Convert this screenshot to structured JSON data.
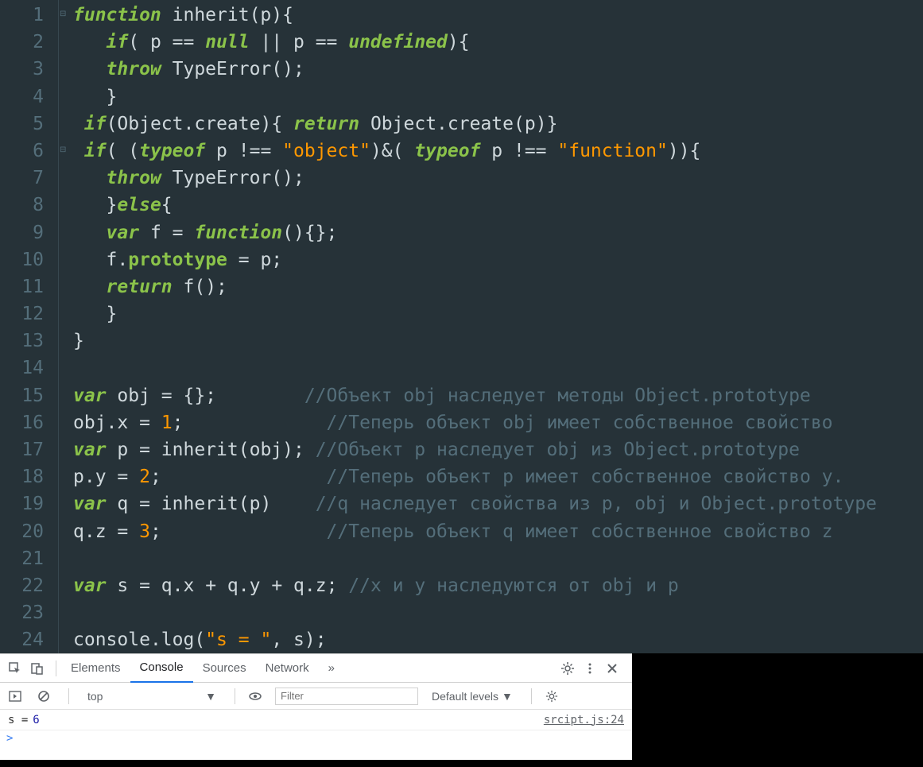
{
  "editor": {
    "line_count": 24,
    "fold_markers": [
      1,
      6
    ],
    "lines": [
      {
        "n": 1,
        "tokens": [
          [
            "kw",
            "function"
          ],
          [
            "fn",
            " inherit"
          ],
          [
            "pun",
            "("
          ],
          [
            "fn",
            "p"
          ],
          [
            "pun",
            "){"
          ]
        ]
      },
      {
        "n": 2,
        "indent": 1,
        "tokens": [
          [
            "kw",
            "if"
          ],
          [
            "pun",
            "( "
          ],
          [
            "fn",
            "p"
          ],
          [
            "op",
            " == "
          ],
          [
            "kw",
            "null"
          ],
          [
            "op",
            " || "
          ],
          [
            "fn",
            "p"
          ],
          [
            "op",
            " == "
          ],
          [
            "kw",
            "undefined"
          ],
          [
            "pun",
            "){"
          ]
        ]
      },
      {
        "n": 3,
        "indent": 1,
        "tokens": [
          [
            "kw",
            "throw"
          ],
          [
            "fn",
            " TypeError"
          ],
          [
            "pun",
            "();"
          ]
        ]
      },
      {
        "n": 4,
        "indent": 1,
        "tokens": [
          [
            "pun",
            "}"
          ]
        ]
      },
      {
        "n": 5,
        "indent": 0,
        "tokens": [
          [
            "kw",
            "if"
          ],
          [
            "pun",
            "("
          ],
          [
            "fn",
            "Object"
          ],
          [
            "pun",
            "."
          ],
          [
            "fn",
            "create"
          ],
          [
            "pun",
            "){ "
          ],
          [
            "kw",
            "return"
          ],
          [
            "fn",
            " Object"
          ],
          [
            "pun",
            "."
          ],
          [
            "fn",
            "create"
          ],
          [
            "pun",
            "("
          ],
          [
            "fn",
            "p"
          ],
          [
            "pun",
            ")}"
          ]
        ]
      },
      {
        "n": 6,
        "indent": 0,
        "tokens": [
          [
            "kw",
            "if"
          ],
          [
            "pun",
            "( ("
          ],
          [
            "kw",
            "typeof"
          ],
          [
            "fn",
            " p"
          ],
          [
            "op",
            " !== "
          ],
          [
            "str",
            "\"object\""
          ],
          [
            "pun",
            ")&( "
          ],
          [
            "kw",
            "typeof"
          ],
          [
            "fn",
            " p"
          ],
          [
            "op",
            " !== "
          ],
          [
            "str",
            "\"function\""
          ],
          [
            "pun",
            ")){"
          ]
        ]
      },
      {
        "n": 7,
        "indent": 1,
        "tokens": [
          [
            "kw",
            "throw"
          ],
          [
            "fn",
            " TypeError"
          ],
          [
            "pun",
            "();"
          ]
        ]
      },
      {
        "n": 8,
        "indent": 1,
        "tokens": [
          [
            "pun",
            "}"
          ],
          [
            "kw",
            "else"
          ],
          [
            "pun",
            "{"
          ]
        ]
      },
      {
        "n": 9,
        "indent": 1,
        "tokens": [
          [
            "kw",
            "var"
          ],
          [
            "fn",
            " f"
          ],
          [
            "op",
            " = "
          ],
          [
            "kw",
            "function"
          ],
          [
            "pun",
            "(){};"
          ]
        ]
      },
      {
        "n": 10,
        "indent": 1,
        "tokens": [
          [
            "fn",
            "f"
          ],
          [
            "pun",
            "."
          ],
          [
            "prop",
            "prototype"
          ],
          [
            "op",
            " = "
          ],
          [
            "fn",
            "p"
          ],
          [
            "pun",
            ";"
          ]
        ]
      },
      {
        "n": 11,
        "indent": 1,
        "tokens": [
          [
            "kw",
            "return"
          ],
          [
            "fn",
            " f"
          ],
          [
            "pun",
            "();"
          ]
        ]
      },
      {
        "n": 12,
        "indent": 1,
        "tokens": [
          [
            "pun",
            "}"
          ]
        ]
      },
      {
        "n": 13,
        "indent": 0,
        "tokens": [
          [
            "pun",
            "}"
          ]
        ]
      },
      {
        "n": 14,
        "indent": 0,
        "tokens": []
      },
      {
        "n": 15,
        "indent": 0,
        "tokens": [
          [
            "kw",
            "var"
          ],
          [
            "fn",
            " obj"
          ],
          [
            "op",
            " = "
          ],
          [
            "pun",
            "{};        "
          ],
          [
            "cmt",
            "//Объект obj наследует методы Object.prototype"
          ]
        ]
      },
      {
        "n": 16,
        "indent": 0,
        "tokens": [
          [
            "fn",
            "obj"
          ],
          [
            "pun",
            "."
          ],
          [
            "fn",
            "x"
          ],
          [
            "op",
            " = "
          ],
          [
            "num",
            "1"
          ],
          [
            "pun",
            ";             "
          ],
          [
            "cmt",
            "//Теперь объект obj имеет собственное свойство"
          ]
        ]
      },
      {
        "n": 17,
        "indent": 0,
        "tokens": [
          [
            "kw",
            "var"
          ],
          [
            "fn",
            " p"
          ],
          [
            "op",
            " = "
          ],
          [
            "fn",
            "inherit"
          ],
          [
            "pun",
            "("
          ],
          [
            "fn",
            "obj"
          ],
          [
            "pun",
            "); "
          ],
          [
            "cmt",
            "//Объект p наследует obj из Object.prototype"
          ]
        ]
      },
      {
        "n": 18,
        "indent": 0,
        "tokens": [
          [
            "fn",
            "p"
          ],
          [
            "pun",
            "."
          ],
          [
            "fn",
            "y"
          ],
          [
            "op",
            " = "
          ],
          [
            "num",
            "2"
          ],
          [
            "pun",
            ";               "
          ],
          [
            "cmt",
            "//Теперь объект p имеет собственное свойство y."
          ]
        ]
      },
      {
        "n": 19,
        "indent": 0,
        "tokens": [
          [
            "kw",
            "var"
          ],
          [
            "fn",
            " q"
          ],
          [
            "op",
            " = "
          ],
          [
            "fn",
            "inherit"
          ],
          [
            "pun",
            "("
          ],
          [
            "fn",
            "p"
          ],
          [
            "pun",
            ")    "
          ],
          [
            "cmt",
            "//q наследует свойства из p, obj и Object.prototype"
          ]
        ]
      },
      {
        "n": 20,
        "indent": 0,
        "tokens": [
          [
            "fn",
            "q"
          ],
          [
            "pun",
            "."
          ],
          [
            "fn",
            "z"
          ],
          [
            "op",
            " = "
          ],
          [
            "num",
            "3"
          ],
          [
            "pun",
            ";               "
          ],
          [
            "cmt",
            "//Теперь объект q имеет собственное свойство z"
          ]
        ]
      },
      {
        "n": 21,
        "indent": 0,
        "tokens": []
      },
      {
        "n": 22,
        "indent": 0,
        "tokens": [
          [
            "kw",
            "var"
          ],
          [
            "fn",
            " s"
          ],
          [
            "op",
            " = "
          ],
          [
            "fn",
            "q"
          ],
          [
            "pun",
            "."
          ],
          [
            "fn",
            "x"
          ],
          [
            "op",
            " + "
          ],
          [
            "fn",
            "q"
          ],
          [
            "pun",
            "."
          ],
          [
            "fn",
            "y"
          ],
          [
            "op",
            " + "
          ],
          [
            "fn",
            "q"
          ],
          [
            "pun",
            "."
          ],
          [
            "fn",
            "z"
          ],
          [
            "pun",
            "; "
          ],
          [
            "cmt",
            "//x и y наследуются от obj и p"
          ]
        ]
      },
      {
        "n": 23,
        "indent": 0,
        "tokens": []
      },
      {
        "n": 24,
        "indent": 0,
        "tokens": [
          [
            "fn",
            "console"
          ],
          [
            "pun",
            "."
          ],
          [
            "fn",
            "log"
          ],
          [
            "pun",
            "("
          ],
          [
            "str",
            "\"s = \""
          ],
          [
            "pun",
            ", "
          ],
          [
            "fn",
            "s"
          ],
          [
            "pun",
            ");"
          ]
        ]
      }
    ]
  },
  "devtools": {
    "tabs": {
      "elements": "Elements",
      "console": "Console",
      "sources": "Sources",
      "network": "Network",
      "more": "»"
    },
    "toolbar": {
      "context": "top",
      "filter_placeholder": "Filter",
      "levels": "Default levels"
    },
    "log": {
      "msg": "s = ",
      "value": "6",
      "source": "srcipt.js:24"
    },
    "prompt": ">"
  }
}
